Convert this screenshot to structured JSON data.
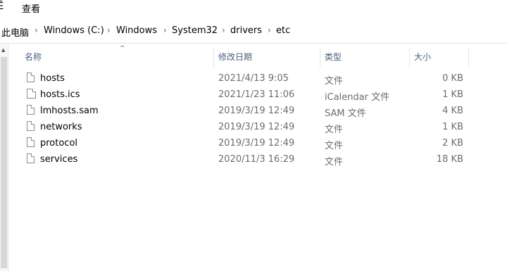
{
  "menubar": {
    "left_fragment": "Ē",
    "view_label": "查看"
  },
  "breadcrumb": {
    "items": [
      "此电脑",
      "Windows (C:)",
      "Windows",
      "System32",
      "drivers",
      "etc"
    ],
    "separator": "›"
  },
  "columns": {
    "name": "名称",
    "date": "修改日期",
    "type": "类型",
    "size": "大小"
  },
  "sort_indicator": "^",
  "files": [
    {
      "name": "hosts",
      "date": "2021/4/13 9:05",
      "type": "文件",
      "size": "0 KB",
      "icon": "file-icon"
    },
    {
      "name": "hosts.ics",
      "date": "2021/1/23 11:06",
      "type": "iCalendar 文件",
      "size": "1 KB",
      "icon": "calendar-file-icon"
    },
    {
      "name": "lmhosts.sam",
      "date": "2019/3/19 12:49",
      "type": "SAM 文件",
      "size": "4 KB",
      "icon": "file-icon"
    },
    {
      "name": "networks",
      "date": "2019/3/19 12:49",
      "type": "文件",
      "size": "1 KB",
      "icon": "file-icon"
    },
    {
      "name": "protocol",
      "date": "2019/3/19 12:49",
      "type": "文件",
      "size": "2 KB",
      "icon": "file-icon"
    },
    {
      "name": "services",
      "date": "2020/11/3 16:29",
      "type": "文件",
      "size": "18 KB",
      "icon": "file-icon"
    }
  ]
}
